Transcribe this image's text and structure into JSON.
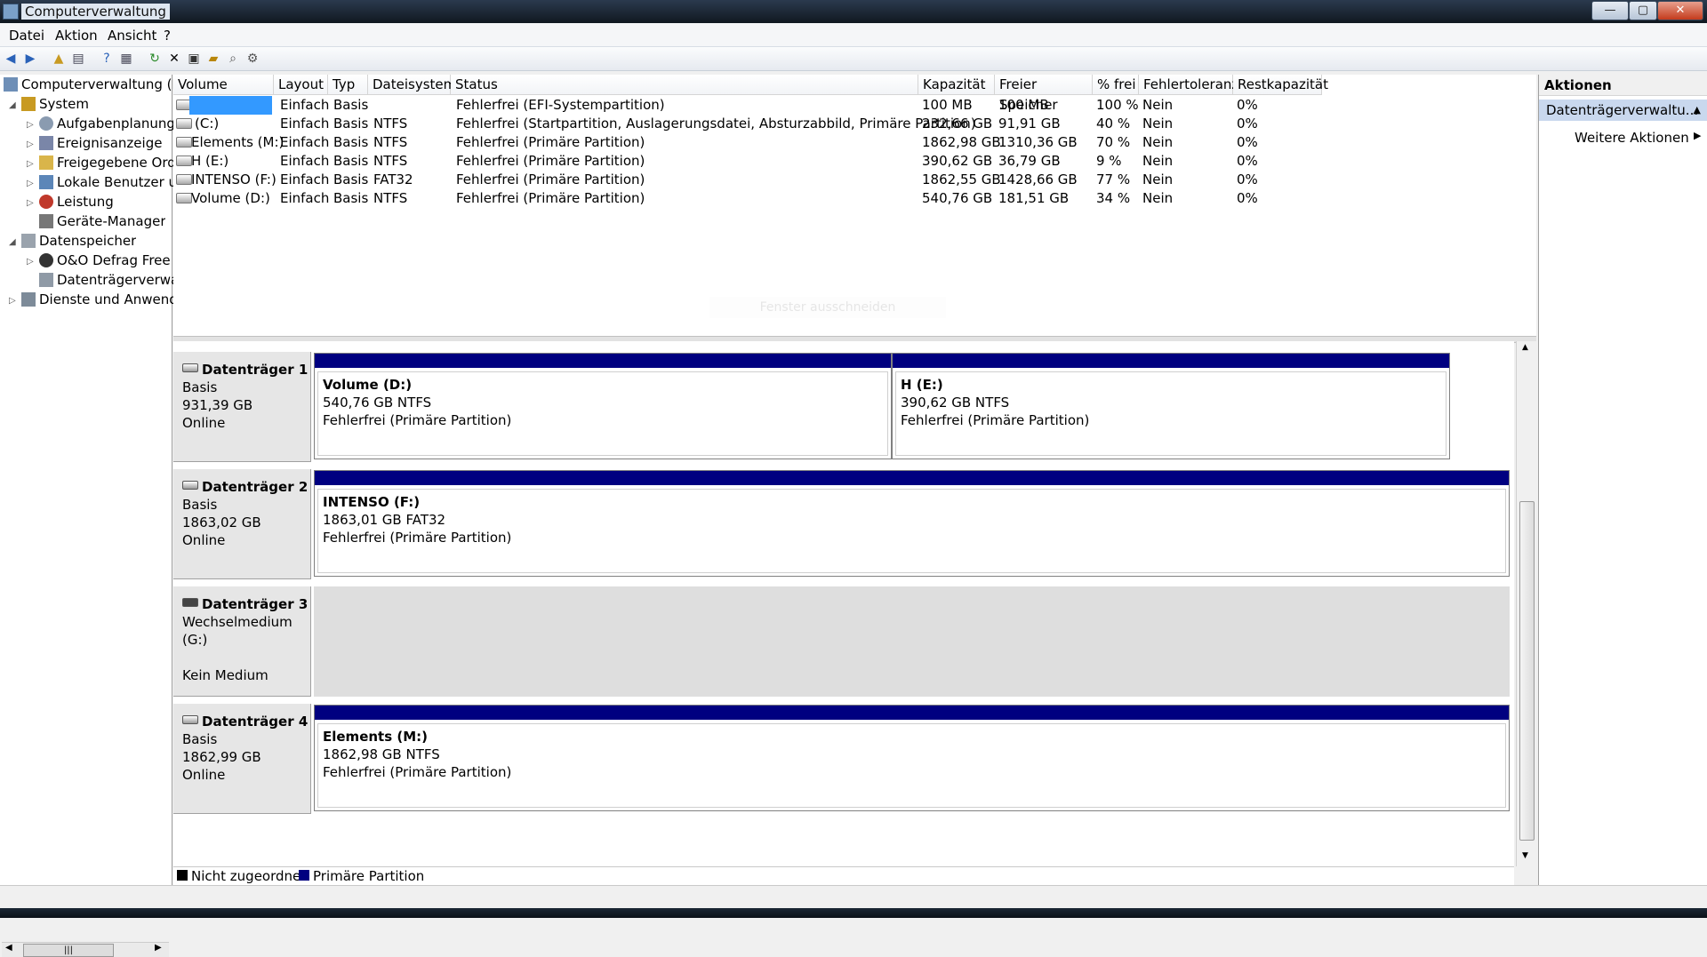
{
  "window": {
    "title": "Computerverwaltung",
    "buttons": {
      "minimize": "—",
      "maximize": "▢",
      "close": "✕"
    }
  },
  "menu": {
    "items": [
      "Datei",
      "Aktion",
      "Ansicht",
      "?"
    ]
  },
  "tree": {
    "root": "Computerverwaltung (Lc",
    "system": "System",
    "aufgaben": "Aufgabenplanung",
    "ereignis": "Ereignisanzeige",
    "freigegeben": "Freigegebene Ordr",
    "lokale": "Lokale Benutzer un",
    "leistung": "Leistung",
    "geraete": "Geräte-Manager",
    "datenspeicher": "Datenspeicher",
    "defrag": "O&O Defrag Free E",
    "datentraeger": "Datenträgerverwal",
    "dienste": "Dienste und Anwendu",
    "scroll_glyph": "|||"
  },
  "table": {
    "columns": [
      "Volume",
      "Layout",
      "Typ",
      "Dateisystem",
      "Status",
      "Kapazität",
      "Freier Speicher",
      "% frei",
      "Fehlertoleranz",
      "Restkapazität"
    ],
    "rows": [
      {
        "volume": "",
        "layout": "Einfach",
        "typ": "Basis",
        "fs": "",
        "status": "Fehlerfrei (EFI-Systempartition)",
        "kap": "100 MB",
        "frei": "100 MB",
        "pct": "100 %",
        "fehler": "Nein",
        "rest": "0%"
      },
      {
        "volume": "(C:)",
        "layout": "Einfach",
        "typ": "Basis",
        "fs": "NTFS",
        "status": "Fehlerfrei (Startpartition, Auslagerungsdatei, Absturzabbild, Primäre Partition)",
        "kap": "232,66 GB",
        "frei": "91,91 GB",
        "pct": "40 %",
        "fehler": "Nein",
        "rest": "0%"
      },
      {
        "volume": "Elements (M:)",
        "layout": "Einfach",
        "typ": "Basis",
        "fs": "NTFS",
        "status": "Fehlerfrei (Primäre Partition)",
        "kap": "1862,98 GB",
        "frei": "1310,36 GB",
        "pct": "70 %",
        "fehler": "Nein",
        "rest": "0%"
      },
      {
        "volume": "H (E:)",
        "layout": "Einfach",
        "typ": "Basis",
        "fs": "NTFS",
        "status": "Fehlerfrei (Primäre Partition)",
        "kap": "390,62 GB",
        "frei": "36,79 GB",
        "pct": "9 %",
        "fehler": "Nein",
        "rest": "0%"
      },
      {
        "volume": "INTENSO (F:)",
        "layout": "Einfach",
        "typ": "Basis",
        "fs": "FAT32",
        "status": "Fehlerfrei (Primäre Partition)",
        "kap": "1862,55 GB",
        "frei": "1428,66 GB",
        "pct": "77 %",
        "fehler": "Nein",
        "rest": "0%"
      },
      {
        "volume": "Volume (D:)",
        "layout": "Einfach",
        "typ": "Basis",
        "fs": "NTFS",
        "status": "Fehlerfrei (Primäre Partition)",
        "kap": "540,76 GB",
        "frei": "181,51 GB",
        "pct": "34 %",
        "fehler": "Nein",
        "rest": "0%"
      }
    ],
    "cut_hint": "Fenster ausschneiden"
  },
  "disks": [
    {
      "name": "Datenträger 1",
      "l1": "Basis",
      "l2": "931,39 GB",
      "l3": "Online",
      "parts": [
        {
          "title": "Volume  (D:)",
          "size": "540,76 GB NTFS",
          "status": "Fehlerfrei (Primäre Partition)"
        },
        {
          "title": "H  (E:)",
          "size": "390,62 GB NTFS",
          "status": "Fehlerfrei (Primäre Partition)"
        }
      ]
    },
    {
      "name": "Datenträger 2",
      "l1": "Basis",
      "l2": "1863,02 GB",
      "l3": "Online",
      "parts": [
        {
          "title": "INTENSO  (F:)",
          "size": "1863,01 GB FAT32",
          "status": "Fehlerfrei (Primäre Partition)"
        }
      ]
    },
    {
      "name": "Datenträger 3",
      "l1": "Wechselmedium (G:)",
      "l2": "",
      "l3": "Kein Medium",
      "parts": []
    },
    {
      "name": "Datenträger 4",
      "l1": "Basis",
      "l2": "1862,99 GB",
      "l3": "Online",
      "parts": [
        {
          "title": "Elements  (M:)",
          "size": "1862,98 GB NTFS",
          "status": "Fehlerfrei (Primäre Partition)"
        }
      ]
    }
  ],
  "legend": {
    "unalloc": "Nicht zugeordnet",
    "primary": "Primäre Partition",
    "unalloc_color": "#000000",
    "primary_color": "#000080"
  },
  "actions": {
    "header": "Aktionen",
    "sub": "Datenträgerverwaltu...",
    "more": "Weitere Aktionen"
  }
}
